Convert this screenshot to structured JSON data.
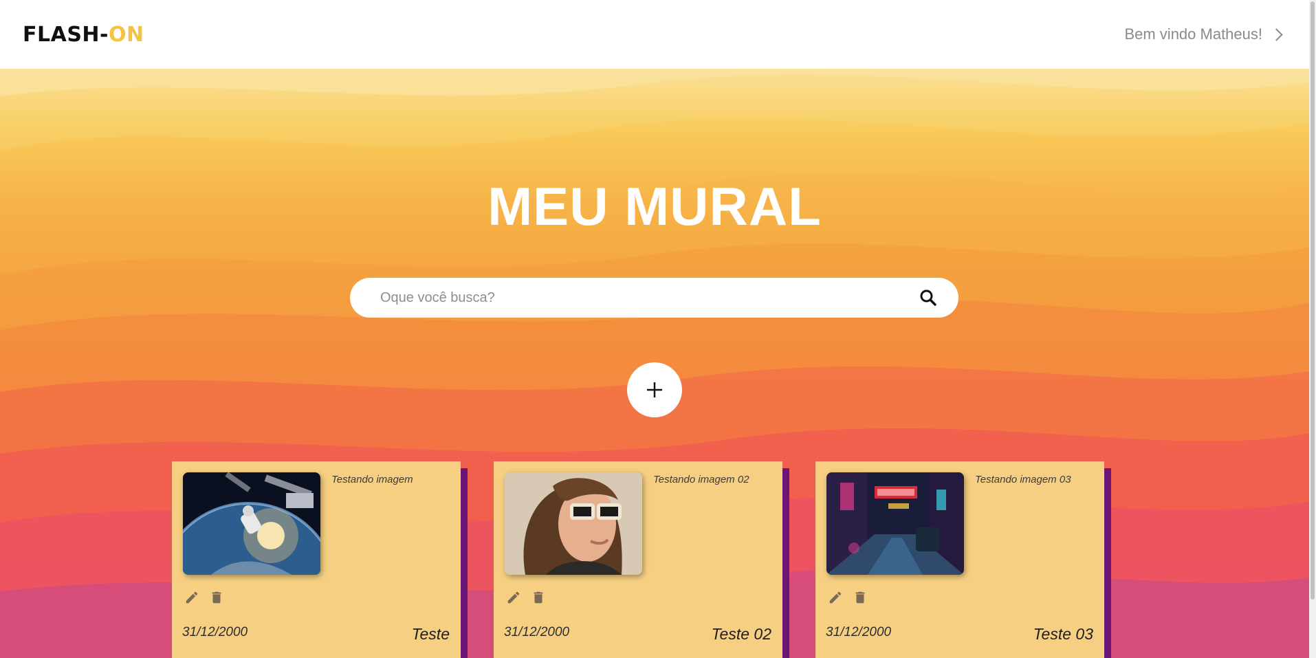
{
  "header": {
    "logo_part1": "FLASH-",
    "logo_part2": "ON",
    "welcome": "Bem vindo Matheus!"
  },
  "hero": {
    "title": "MEU MURAL",
    "search_placeholder": "Oque você busca?"
  },
  "cards": [
    {
      "description": "Testando imagem",
      "date": "31/12/2000",
      "name": "Teste"
    },
    {
      "description": "Testando imagem 02",
      "date": "31/12/2000",
      "name": "Teste 02"
    },
    {
      "description": "Testando imagem 03",
      "date": "31/12/2000",
      "name": "Teste 03"
    }
  ],
  "icons": {
    "search": "search-icon",
    "add": "plus-icon",
    "edit": "pencil-icon",
    "delete": "trash-icon",
    "welcome_arrow": "chevron-right-icon"
  },
  "colors": {
    "logo_accent": "#f5c242",
    "card_bg": "#f6cf82",
    "card_shadow": "#6b1577"
  }
}
